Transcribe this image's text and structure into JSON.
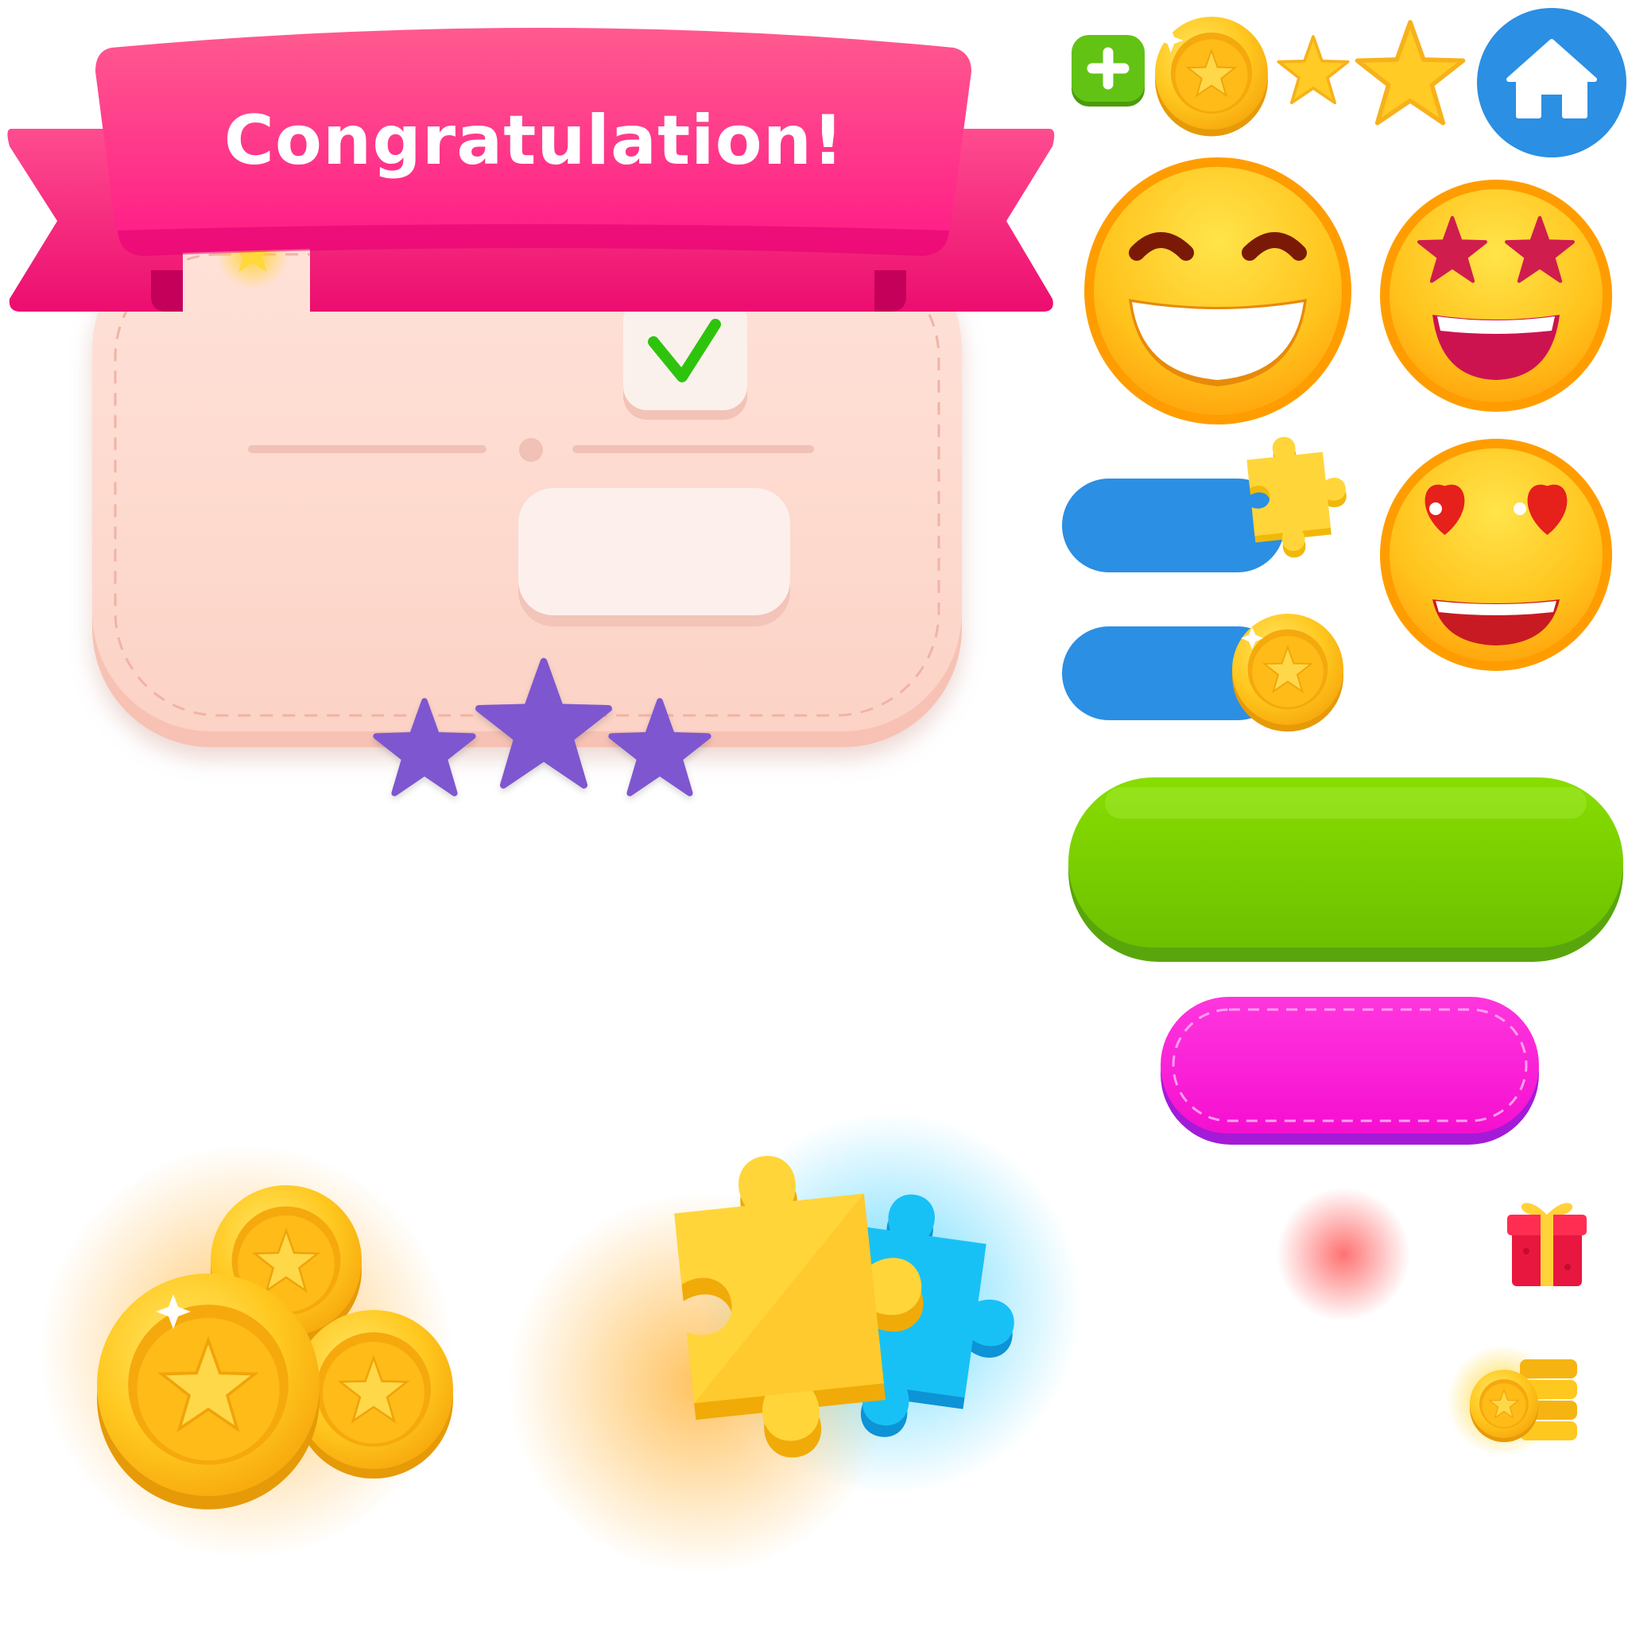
{
  "title_banner": {
    "text": "Congratulation!"
  },
  "panel": {
    "checkbox_checked": true
  },
  "rating": {
    "earned": 3,
    "total": 3
  },
  "colors": {
    "ribbon": "#ff1f82",
    "panel": "#fdd8cc",
    "star_purple": "#8057d0",
    "toggle_blue": "#2b8fe3",
    "green_button": "#7ccd00",
    "magenta_button": "#ff1ad5",
    "home_blue": "#2b8fe3",
    "plus_green": "#5dbb0c",
    "gold": "#ffc21a",
    "puzzle_yellow": "#ffd53a",
    "puzzle_blue": "#10b8f0",
    "gift_red": "#e8173f"
  },
  "icons": [
    "plus-icon",
    "coin-icon",
    "star-icon",
    "home-icon",
    "grin-emoji",
    "star-eyes-emoji",
    "heart-eyes-emoji",
    "puzzle-piece-icon",
    "coin-pile-icon",
    "gift-icon",
    "coin-stack-icon"
  ]
}
